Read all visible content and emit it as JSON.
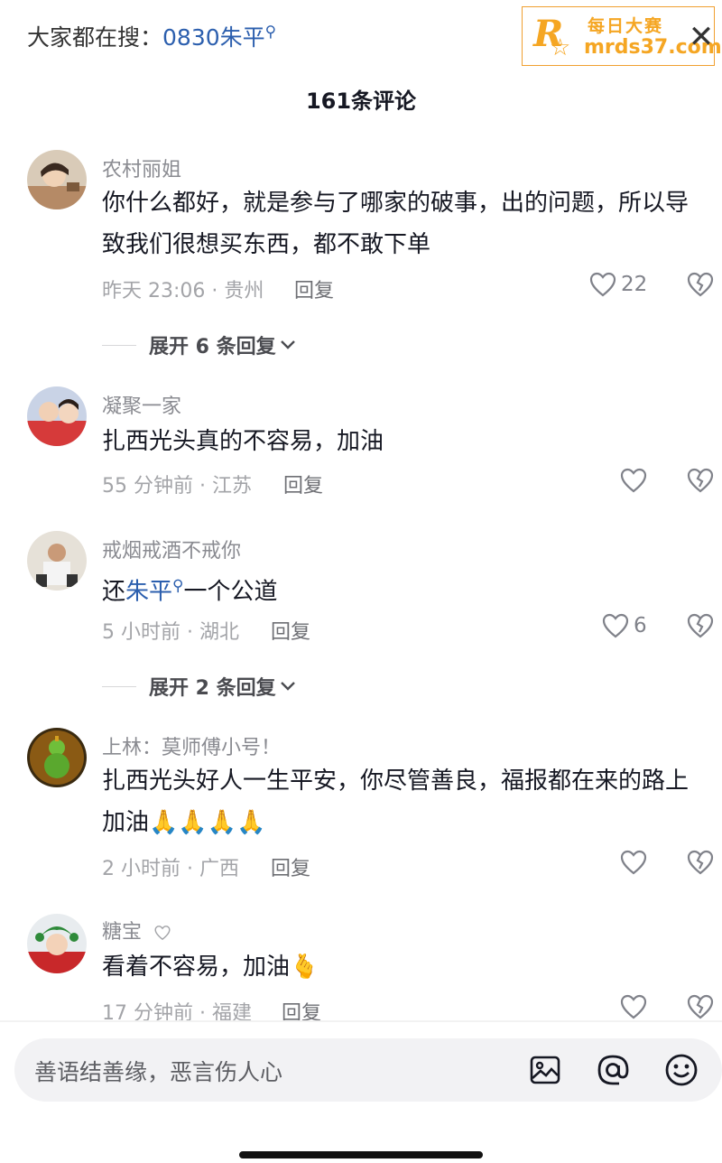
{
  "header": {
    "search_prefix": "大家都在搜：",
    "search_keyword": "0830朱平",
    "comment_count": "161条评论",
    "close_icon": "close-icon"
  },
  "watermark": {
    "logo_letter": "R",
    "name": "每日大赛",
    "url": "mrds37.com",
    "color": "#f5a623"
  },
  "comments": [
    {
      "user": "农村丽姐",
      "text": "你什么都好，就是参与了哪家的破事，出的问题，所以导致我们很想买东西，都不敢下单",
      "time_location": "昨天 23:06 · 贵州",
      "reply_label": "回复",
      "likes": "22",
      "expand_label": "展开 6 条回复"
    },
    {
      "user": "凝聚一家",
      "text": "扎西光头真的不容易，加油",
      "time_location": "55 分钟前 · 江苏",
      "reply_label": "回复",
      "likes": ""
    },
    {
      "user": "戒烟戒酒不戒你",
      "text_pre": "还",
      "text_keyword": "朱平",
      "text_post": "一个公道",
      "time_location": "5 小时前 · 湖北",
      "reply_label": "回复",
      "likes": "6",
      "expand_label": "展开 2 条回复"
    },
    {
      "user": "上林：莫师傅小号！",
      "text": "扎西光头好人一生平安，你尽管善良，福报都在来的路上加油🙏🙏🙏🙏",
      "time_location": "2 小时前 · 广西",
      "reply_label": "回复",
      "likes": ""
    },
    {
      "user": "糖宝",
      "text": "看着不容易，加油🫰",
      "time_location": "17 分钟前 · 福建",
      "reply_label": "回复",
      "likes": ""
    }
  ],
  "input": {
    "placeholder": "善语结善缘，恶言伤人心"
  },
  "colors": {
    "keyword_link": "#2c5fae",
    "meta_gray": "#a3a4a8",
    "text_dark": "#161823"
  }
}
